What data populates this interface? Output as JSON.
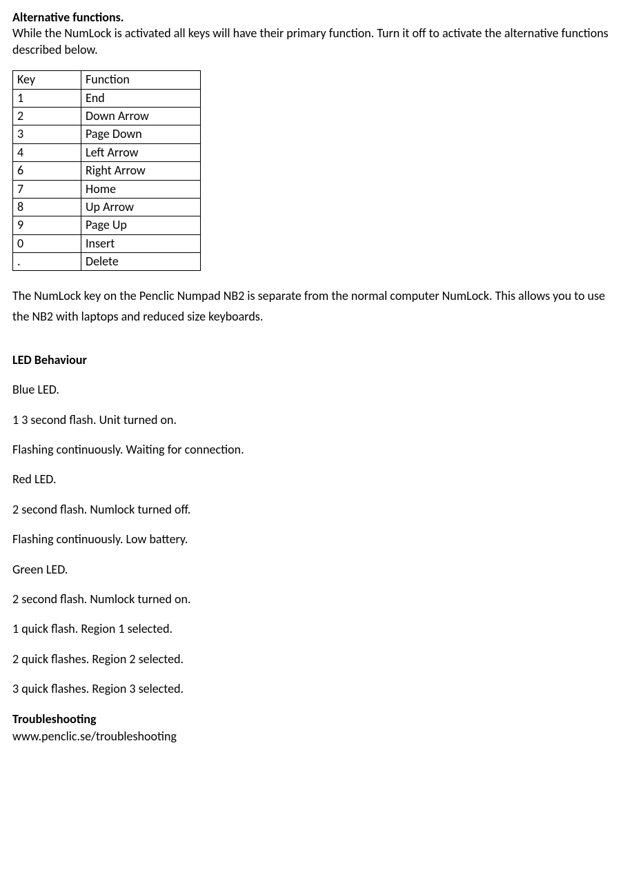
{
  "section1": {
    "heading": "Alternative functions.",
    "intro": "While the NumLock is activated all keys will have their primary function. Turn it off to activate the alternative functions described below.",
    "table": {
      "header": {
        "key": "Key",
        "function": "Function"
      },
      "rows": [
        {
          "key": "1",
          "function": "End"
        },
        {
          "key": "2",
          "function": "Down Arrow"
        },
        {
          "key": "3",
          "function": "Page Down"
        },
        {
          "key": "4",
          "function": "Left Arrow"
        },
        {
          "key": "6",
          "function": "Right Arrow"
        },
        {
          "key": "7",
          "function": "Home"
        },
        {
          "key": "8",
          "function": "Up Arrow"
        },
        {
          "key": "9",
          "function": "Page Up"
        },
        {
          "key": "0",
          "function": "Insert"
        },
        {
          "key": ".",
          "function": "Delete"
        }
      ]
    },
    "note": "The NumLock key on the Penclic Numpad NB2 is separate from the normal computer NumLock. This allows you to use the NB2 with laptops and reduced size keyboards."
  },
  "section2": {
    "heading": "LED Behaviour",
    "lines": [
      "Blue LED.",
      "1 3 second flash. Unit turned on.",
      "Flashing continuously. Waiting for connection.",
      "Red LED.",
      "2 second flash. Numlock turned off.",
      "Flashing continuously. Low battery.",
      "Green LED.",
      "2 second flash. Numlock turned on.",
      "1 quick flash. Region 1 selected.",
      "2 quick flashes. Region 2 selected.",
      "3 quick flashes. Region 3 selected."
    ]
  },
  "section3": {
    "heading": "Troubleshooting",
    "url": "www.penclic.se/troubleshooting"
  }
}
